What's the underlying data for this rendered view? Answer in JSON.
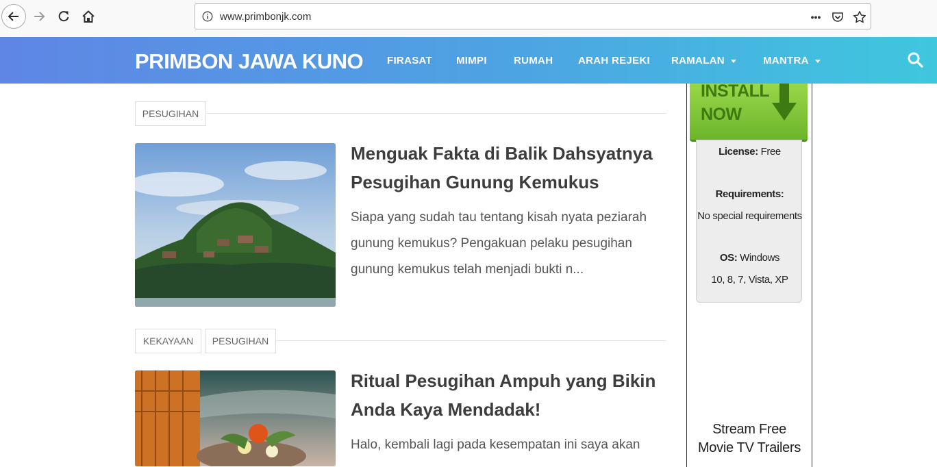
{
  "browser": {
    "url": "www.primbonjk.com",
    "menu_dots": "•••"
  },
  "site": {
    "title": "PRIMBON JAWA KUNO",
    "menu": [
      {
        "label": "FIRASAT"
      },
      {
        "label": "MIMPI"
      },
      {
        "label": "RUMAH"
      },
      {
        "label": "ARAH REJEKI"
      },
      {
        "label": "RAMALAN"
      },
      {
        "label": "MANTRA"
      }
    ]
  },
  "posts": [
    {
      "tags": [
        "PESUGIHAN"
      ],
      "title": "Menguak Fakta di Balik Dahsyatnya Pesugihan Gunung Kemukus",
      "excerpt": "Siapa yang sudah tau tentang kisah nyata peziarah gunung kemukus? Pengakuan pelaku pesugihan gunung kemukus telah menjadi bukti n..."
    },
    {
      "tags": [
        "KEKAYAAN",
        "PESUGIHAN"
      ],
      "title": "Ritual Pesugihan Ampuh yang Bikin Anda Kaya Mendadak!",
      "excerpt": "Halo, kembali lagi pada kesempatan ini saya akan"
    }
  ],
  "sidebar": {
    "install_line1": "INSTALL",
    "install_line2": "NOW",
    "license_label": "License:",
    "license_value": " Free",
    "requirements_label": "Requirements:",
    "requirements_value": "No special requirements",
    "os_label": "OS:",
    "os_value_1": " Windows",
    "os_value_2": "10, 8, 7, Vista, XP",
    "stream_line1": "Stream Free",
    "stream_line2": "Movie TV Trailers"
  },
  "colors": {
    "header_gradient_start": "#5f86e5",
    "header_gradient_end": "#3fc7de",
    "install_green": "#6bb52b"
  }
}
